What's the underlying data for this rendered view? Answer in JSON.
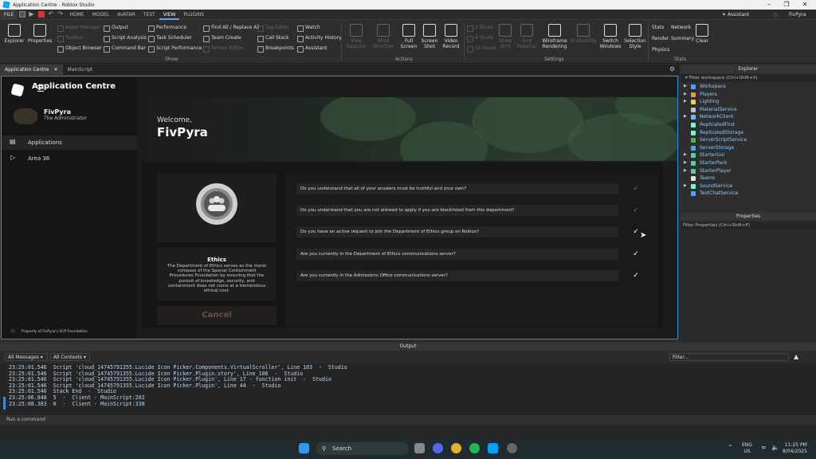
{
  "window": {
    "title": "Application Centre - Roblox Studio"
  },
  "menu": {
    "tabs": [
      "FILE",
      "HOME",
      "MODEL",
      "AVATAR",
      "TEST",
      "VIEW",
      "PLUGINS"
    ],
    "active": "VIEW",
    "assistant": "Assistant",
    "user": "FivPyra"
  },
  "ribbon": {
    "show_group": {
      "label": "Show",
      "explorer": "Explorer",
      "properties": "Properties",
      "items": [
        "Asset Manager",
        "Toolbox",
        "Object Browser",
        "Output",
        "Script Analysis",
        "Command Bar",
        "Performance",
        "Task Scheduler",
        "Script Performance",
        "Find All / Replace All",
        "Team Create",
        "Terrain Editor",
        "Tag Editor",
        "Call Stack",
        "Breakpoints",
        "Watch",
        "Activity History",
        "Assistant"
      ]
    },
    "actions_group": {
      "label": "Actions",
      "items": [
        "View Selector",
        "Mind Direction",
        "Full Screen",
        "Screen Shot",
        "Video Record"
      ]
    },
    "settings_group": {
      "label": "Settings",
      "studs": [
        "2 Studs",
        "4 Studs",
        "16 Studs"
      ],
      "items": [
        "Show Grid",
        "Grid Material",
        "Wireframe Rendering",
        "UI Visibility",
        "Switch Windows",
        "Selection Style"
      ]
    },
    "stats_group": {
      "label": "Stats",
      "items": [
        "Stats",
        "Network",
        "Render",
        "Summary",
        "Physics",
        "Clear"
      ]
    }
  },
  "doc_tabs": [
    "Application Centre",
    "MainScript"
  ],
  "app": {
    "header_title": "Application Centre",
    "profile": {
      "name": "FivPyra",
      "role": "The Administrator"
    },
    "nav": [
      {
        "label": "Applications",
        "icon": "list-icon"
      },
      {
        "label": "Area 36",
        "icon": "play-icon"
      }
    ],
    "footer": "Property of FivPyra's SCP Foundation",
    "welcome": "Welcome,",
    "username": "FivPyra",
    "department": {
      "name": "Ethics",
      "description": "The Department of Ethics serves as the moral compass of the Special Containment Procedures Foundation by ensuring that the pursuit of knowledge, security, and containment does not come at a tremendous ethical cost."
    },
    "cancel": "Cancel",
    "questions": [
      {
        "text": "Do you understand that all of your answers must be truthful and your own?",
        "checked": false
      },
      {
        "text": "Do you understand that you are not allowed to apply if you are blacklisted from this department?",
        "checked": false
      },
      {
        "text": "Do you have an active request to join the Department of Ethics group on Roblox?",
        "checked": true
      },
      {
        "text": "Are you currently in the Department of Ethics communications server?",
        "checked": true
      },
      {
        "text": "Are you currently in the Admissions Office communications server?",
        "checked": true
      }
    ]
  },
  "explorer": {
    "title": "Explorer",
    "filter": "Filter workspace (Ctrl+Shift+X)",
    "items": [
      "Workspace",
      "Players",
      "Lighting",
      "MaterialService",
      "NetworkClient",
      "ReplicatedFirst",
      "ReplicatedStorage",
      "ServerScriptService",
      "ServerStorage",
      "StarterGui",
      "StarterPack",
      "StarterPlayer",
      "Teams",
      "SoundService",
      "TextChatService"
    ]
  },
  "properties": {
    "title": "Properties",
    "filter": "Filter Properties (Ctrl+Shift+P)"
  },
  "output": {
    "title": "Output",
    "messages_filter": "All Messages",
    "context_filter": "All Contexts",
    "search_placeholder": "Filter...",
    "lines": [
      "23:25:01.546  Script 'cloud_14745791355.Lucide Icon Picker.Components.VirtualScroller', Line 103  -  Studio",
      "23:25:01.546  Script 'cloud_14745791355.Lucide Icon Picker.Plugin.story', Line 106  -  Studio",
      "23:25:01.546  Script 'cloud_14745791355.Lucide Icon Picker.Plugin', Line 17 - function init  -  Studio",
      "23:25:01.546  Script 'cloud_14745791355.Lucide Icon Picker.Plugin', Line 44  -  Studio",
      "23:25:01.546  Stack End  -  Studio",
      "23:25:06.848  5  -  Client - MainScript:202",
      "23:25:08.383  0  -  Client - MainScript:338"
    ],
    "command_placeholder": "Run a command"
  },
  "taskbar": {
    "search": "Search",
    "lang": "ENG",
    "region": "US",
    "time": "11:25 PM",
    "date": "8/04/2025"
  }
}
